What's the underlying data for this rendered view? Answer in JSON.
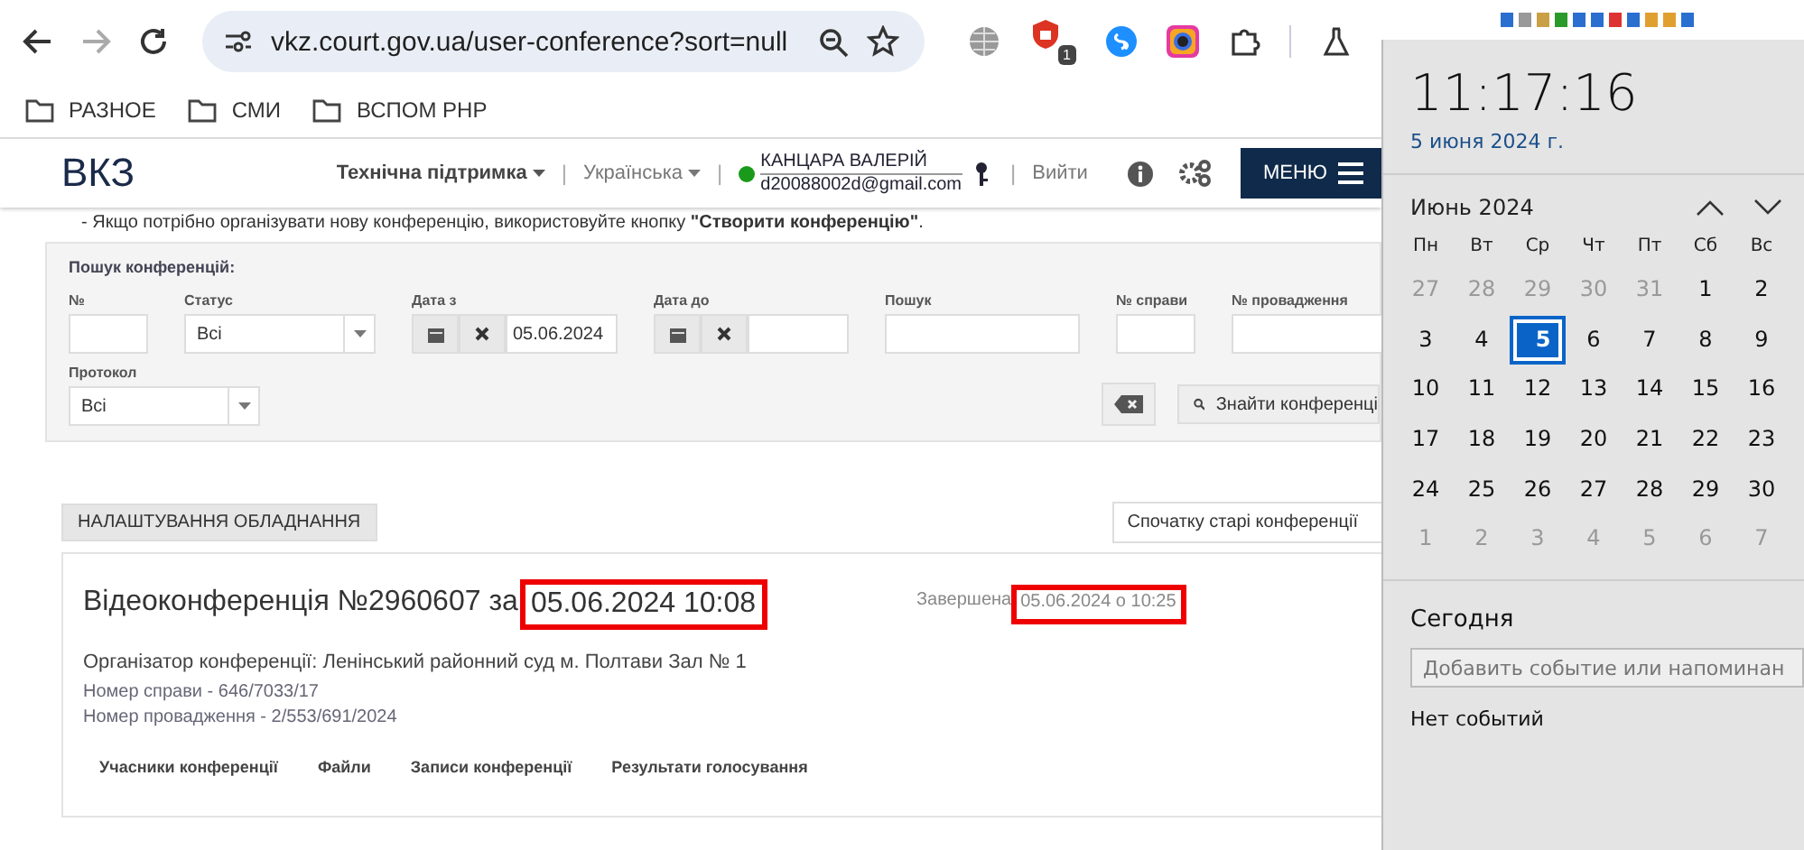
{
  "browser": {
    "url": "vkz.court.gov.ua/user-conference?sort=null",
    "forward_disabled": true,
    "extension_badge": "1",
    "bookmarks": [
      "РАЗНОЕ",
      "СМИ",
      "ВСПОМ PHP"
    ]
  },
  "header": {
    "logo": "ВКЗ",
    "support": "Технічна підтримка",
    "language": "Українська",
    "user_name": "КАНЦАРА ВАЛЕРІЙ",
    "user_email": "d20088002d@gmail.com",
    "logout": "Вийти",
    "separators": [
      "|",
      "|",
      "|"
    ],
    "menu": "МЕНЮ"
  },
  "notice": "- Якщо потрібно організувати нову конференцію, використовуйте кнопку **\"Створити конференцію\"**.",
  "search": {
    "title": "Пошук конференцій:",
    "fields": [
      {
        "kind": "text",
        "label": "№"
      },
      {
        "kind": "select",
        "label": "Статус",
        "value": "Всі"
      },
      {
        "kind": "date",
        "label": "Дата з",
        "value": "05.06.2024"
      },
      {
        "kind": "date",
        "label": "Дата до"
      },
      {
        "kind": "text",
        "label": "Пошук"
      },
      {
        "kind": "text",
        "label": "№ справи"
      },
      {
        "kind": "text",
        "label": "№ провадження"
      }
    ],
    "protocol": {
      "label": "Протокол",
      "value": "Всі"
    },
    "find_button": "Знайти конференці"
  },
  "settings_button": "НАЛАШТУВАННЯ ОБЛАДНАННЯ",
  "sort": {
    "value": "Спочатку старі конференції"
  },
  "conference": {
    "title": "Відеоконференція №2960607 за",
    "date": "05.06.2024 10:08",
    "status": "Завершена",
    "finished": "05.06.2024 о 10:25",
    "organizer": "Організатор конференції: Ленінський районний суд м. Полтави Зал № 1",
    "case_number": "Номер справи - 646/7033/17",
    "proceeding_number": "Номер провадження - 2/553/691/2024",
    "tabs": [
      "Учасники конференції",
      "Файли",
      "Записи конференції",
      "Результати голосування"
    ]
  },
  "clock": {
    "time": "11:17:16",
    "date": "5 июня 2024 г.",
    "month": "Июнь 2024",
    "weekdays": [
      "Пн",
      "Вт",
      "Ср",
      "Чт",
      "Пт",
      "Сб",
      "Вс"
    ],
    "days": [
      {
        "label": "27",
        "muted": true,
        "selected": false
      },
      {
        "label": "28",
        "muted": true,
        "selected": false
      },
      {
        "label": "29",
        "muted": true,
        "selected": false
      },
      {
        "label": "30",
        "muted": true,
        "selected": false
      },
      {
        "label": "31",
        "muted": true,
        "selected": false
      },
      {
        "label": "1",
        "muted": false,
        "selected": false
      },
      {
        "label": "2",
        "muted": false,
        "selected": false
      },
      {
        "label": "3",
        "muted": false,
        "selected": false
      },
      {
        "label": "4",
        "muted": false,
        "selected": false
      },
      {
        "label": "5",
        "muted": false,
        "selected": true
      },
      {
        "label": "6",
        "muted": false,
        "selected": false
      },
      {
        "label": "7",
        "muted": false,
        "selected": false
      },
      {
        "label": "8",
        "muted": false,
        "selected": false
      },
      {
        "label": "9",
        "muted": false,
        "selected": false
      },
      {
        "label": "10",
        "muted": false,
        "selected": false
      },
      {
        "label": "11",
        "muted": false,
        "selected": false
      },
      {
        "label": "12",
        "muted": false,
        "selected": false
      },
      {
        "label": "13",
        "muted": false,
        "selected": false
      },
      {
        "label": "14",
        "muted": false,
        "selected": false
      },
      {
        "label": "15",
        "muted": false,
        "selected": false
      },
      {
        "label": "16",
        "muted": false,
        "selected": false
      },
      {
        "label": "17",
        "muted": false,
        "selected": false
      },
      {
        "label": "18",
        "muted": false,
        "selected": false
      },
      {
        "label": "19",
        "muted": false,
        "selected": false
      },
      {
        "label": "20",
        "muted": false,
        "selected": false
      },
      {
        "label": "21",
        "muted": false,
        "selected": false
      },
      {
        "label": "22",
        "muted": false,
        "selected": false
      },
      {
        "label": "23",
        "muted": false,
        "selected": false
      },
      {
        "label": "24",
        "muted": false,
        "selected": false
      },
      {
        "label": "25",
        "muted": false,
        "selected": false
      },
      {
        "label": "26",
        "muted": false,
        "selected": false
      },
      {
        "label": "27",
        "muted": false,
        "selected": false
      },
      {
        "label": "28",
        "muted": false,
        "selected": false
      },
      {
        "label": "29",
        "muted": false,
        "selected": false
      },
      {
        "label": "30",
        "muted": false,
        "selected": false
      },
      {
        "label": "1",
        "muted": true,
        "selected": false
      },
      {
        "label": "2",
        "muted": true,
        "selected": false
      },
      {
        "label": "3",
        "muted": true,
        "selected": false
      },
      {
        "label": "4",
        "muted": true,
        "selected": false
      },
      {
        "label": "5",
        "muted": true,
        "selected": false
      },
      {
        "label": "6",
        "muted": true,
        "selected": false
      },
      {
        "label": "7",
        "muted": true,
        "selected": false
      }
    ],
    "today": "Сегодня",
    "event_placeholder": "Добавить событие или напоминан",
    "no_events": "Нет событий"
  }
}
